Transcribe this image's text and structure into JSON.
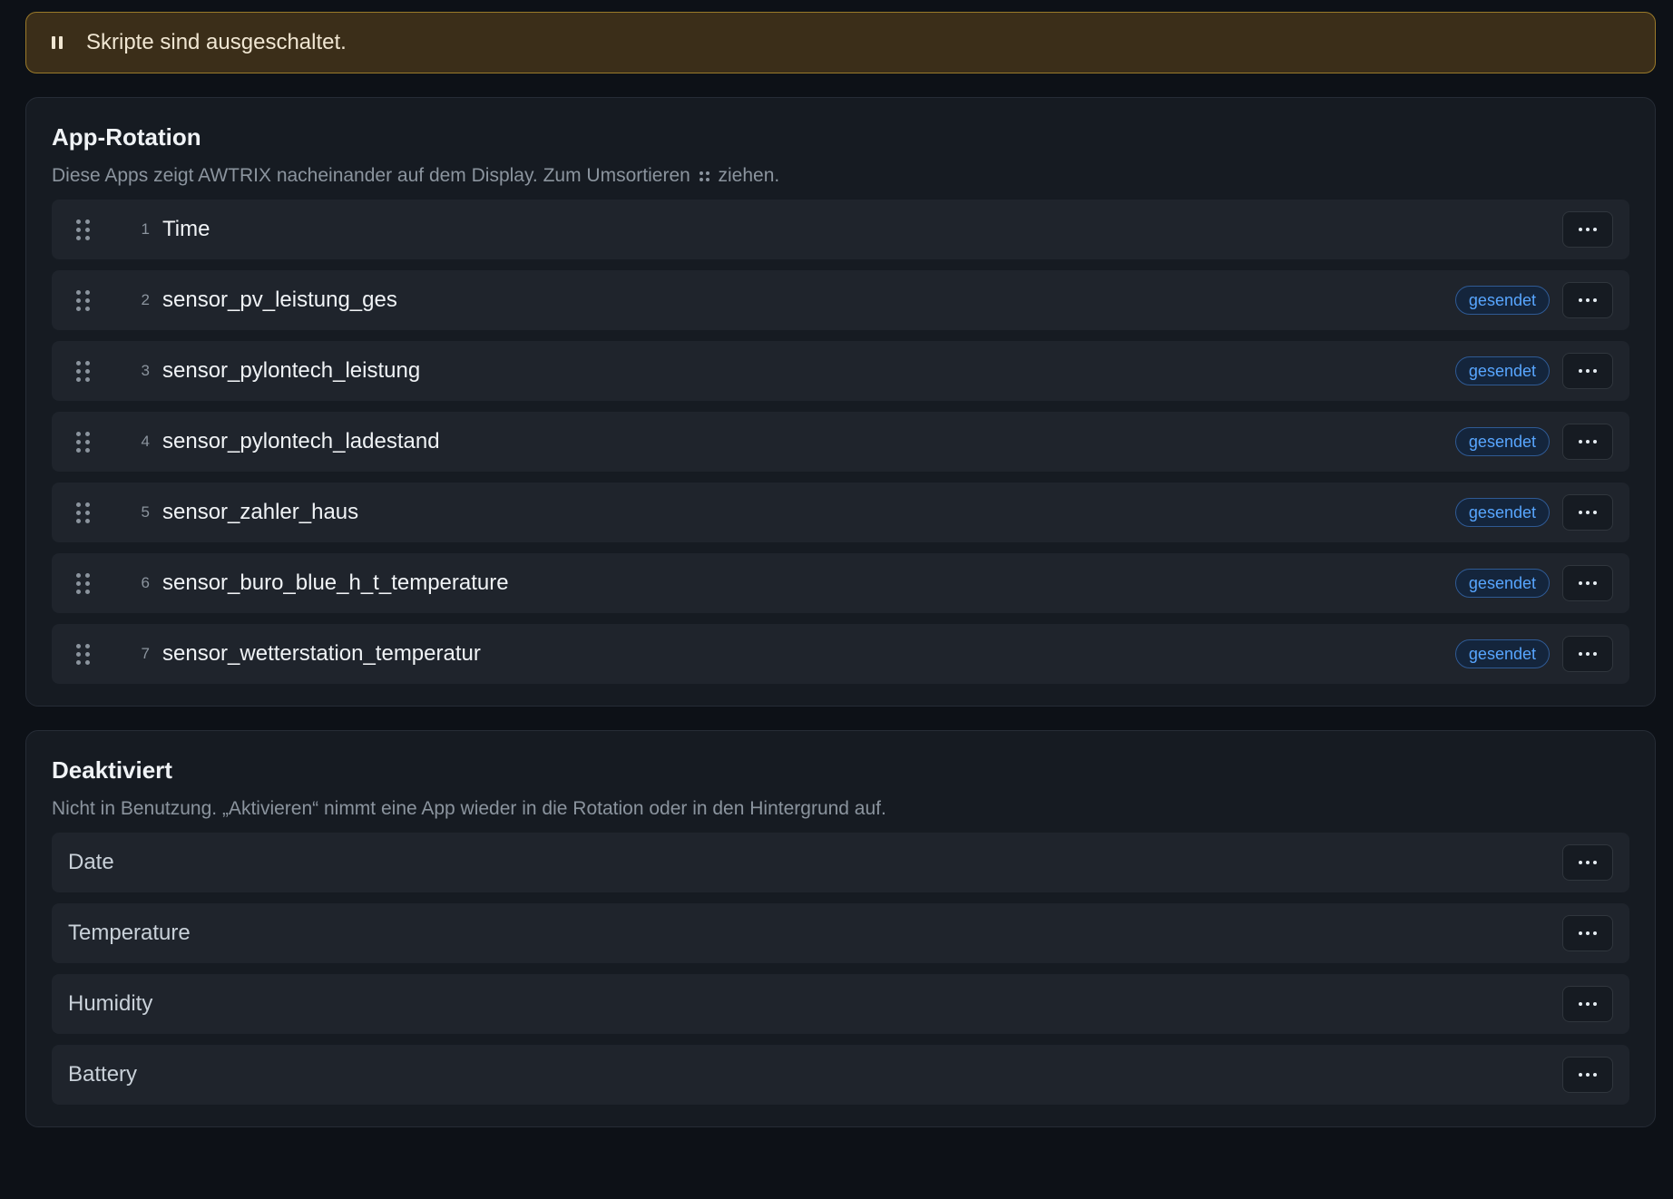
{
  "banner": {
    "icon": "pause-icon",
    "text": "Skripte sind ausgeschaltet."
  },
  "rotation": {
    "title": "App-Rotation",
    "desc_before": "Diese Apps zeigt AWTRIX nacheinander auf dem Display. Zum Umsortieren",
    "desc_after": "ziehen.",
    "items": [
      {
        "num": "1",
        "name": "Time",
        "badge": ""
      },
      {
        "num": "2",
        "name": "sensor_pv_leistung_ges",
        "badge": "gesendet"
      },
      {
        "num": "3",
        "name": "sensor_pylontech_leistung",
        "badge": "gesendet"
      },
      {
        "num": "4",
        "name": "sensor_pylontech_ladestand",
        "badge": "gesendet"
      },
      {
        "num": "5",
        "name": "sensor_zahler_haus",
        "badge": "gesendet"
      },
      {
        "num": "6",
        "name": "sensor_buro_blue_h_t_temperature",
        "badge": "gesendet"
      },
      {
        "num": "7",
        "name": "sensor_wetterstation_temperatur",
        "badge": "gesendet"
      }
    ]
  },
  "disabled": {
    "title": "Deaktiviert",
    "desc": "Nicht in Benutzung. „Aktivieren“ nimmt eine App wieder in die Rotation oder in den Hintergrund auf.",
    "items": [
      {
        "name": "Date"
      },
      {
        "name": "Temperature"
      },
      {
        "name": "Humidity"
      },
      {
        "name": "Battery"
      }
    ]
  },
  "colors": {
    "accent": "#58a6ff",
    "warning_border": "#9a7a2a",
    "warning_bg": "#3b2e19"
  }
}
